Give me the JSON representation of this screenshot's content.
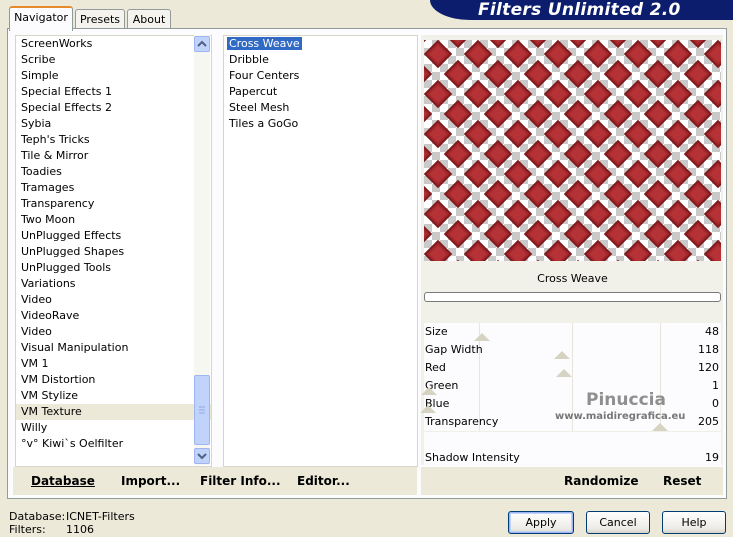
{
  "app": {
    "banner_title": "Filters Unlimited 2.0",
    "tabs": [
      "Navigator",
      "Presets",
      "About"
    ]
  },
  "categories": [
    "ScreenWorks",
    "Scribe",
    "Simple",
    "Special Effects 1",
    "Special Effects 2",
    "Sybia",
    "Teph's Tricks",
    "Tile & Mirror",
    "Toadies",
    "Tramages",
    "Transparency",
    "Two Moon",
    "UnPlugged Effects",
    "UnPlugged Shapes",
    "UnPlugged Tools",
    "Variations",
    "Video",
    "VideoRave",
    "Video",
    "Visual Manipulation",
    "VM 1",
    "VM Distortion",
    "VM Stylize",
    "VM Texture",
    "Willy",
    "°v° Kiwi`s Oelfilter"
  ],
  "selected_category": "VM Texture",
  "filters": [
    "Cross Weave",
    "Dribble",
    "Four Centers",
    "Papercut",
    "Steel Mesh",
    "Tiles a GoGo"
  ],
  "selected_filter": "Cross Weave",
  "left_buttons": {
    "database": "Database",
    "import": "Import...",
    "filter_info": "Filter Info...",
    "editor": "Editor..."
  },
  "preview": {
    "filter_name": "Cross Weave",
    "colors": {
      "diamond": "#a4282c",
      "checker": "#c9c9c9"
    }
  },
  "params": [
    {
      "name": "Size",
      "value": "48"
    },
    {
      "name": "Gap Width",
      "value": "118"
    },
    {
      "name": "Red",
      "value": "120"
    },
    {
      "name": "Green",
      "value": "1"
    },
    {
      "name": "Blue",
      "value": "0"
    },
    {
      "name": "Transparency",
      "value": "205"
    },
    {
      "name": "Shadow Intensity",
      "value": "19"
    }
  ],
  "right_buttons": {
    "randomize": "Randomize",
    "reset": "Reset"
  },
  "watermark": {
    "line1": "Pinuccia",
    "line2": "www.maidiregrafica.eu"
  },
  "status": {
    "database_label": "Database:",
    "database_value": "ICNET-Filters",
    "filters_label": "Filters:",
    "filters_value": "1106"
  },
  "dialog_buttons": {
    "apply": "Apply",
    "cancel": "Cancel",
    "help": "Help"
  }
}
